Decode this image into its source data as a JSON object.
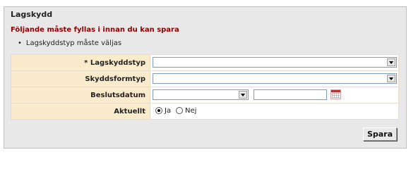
{
  "panel": {
    "title": "Lagskydd",
    "error_title": "Följande måste fyllas i innan du kan spara",
    "errors": [
      "Lagskyddstyp måste väljas"
    ]
  },
  "form": {
    "rows": [
      {
        "label": "* Lagskyddstyp",
        "type": "select",
        "value": ""
      },
      {
        "label": "Skyddsformtyp",
        "type": "select",
        "value": ""
      },
      {
        "label": "Beslutsdatum",
        "type": "date",
        "select_value": "",
        "text_value": ""
      },
      {
        "label": "Aktuellt",
        "type": "radio",
        "options": [
          "Ja",
          "Nej"
        ],
        "selected": "Ja"
      }
    ]
  },
  "buttons": {
    "save_label": "Spara"
  },
  "colors": {
    "label_bg": "#fbebcd",
    "error_text": "#8b0000",
    "panel_bg": "#e8e8e8"
  }
}
